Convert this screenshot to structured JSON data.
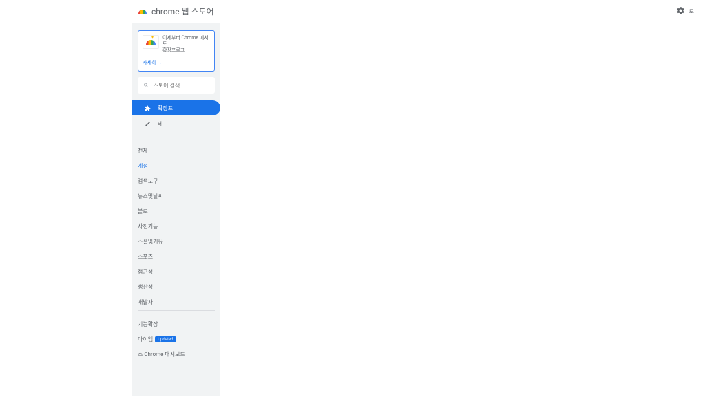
{
  "header": {
    "title": "chrome 웹 스토어",
    "right_text": "로"
  },
  "promo": {
    "line1": "이제부터 Chrome 에서도",
    "line2": "확장프로그",
    "link": "자세히 →"
  },
  "search": {
    "placeholder": "스토어 검색"
  },
  "tabs": {
    "extensions": "확장프",
    "themes": "테"
  },
  "categories": [
    "전체",
    "계정",
    "검색도구",
    "뉴스및날씨",
    "블로",
    "사진기능",
    "소셜및커뮤",
    "스포츠",
    "접근성",
    "생산성",
    "개발자"
  ],
  "bottom": {
    "link1": "기능확장",
    "link2_text": "마이앱",
    "link2_badge": "Updated",
    "link3": "소 Chrome 대시보드"
  }
}
